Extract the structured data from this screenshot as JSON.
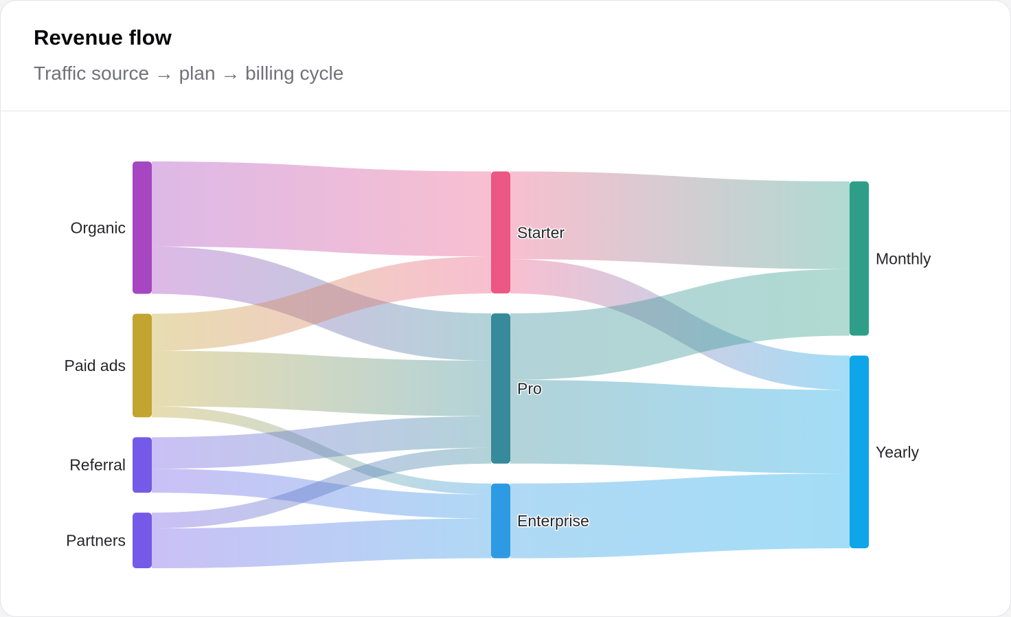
{
  "header": {
    "title": "Revenue flow",
    "subtitle": "Traffic source → plan → billing cycle"
  },
  "chart_data": {
    "type": "sankey",
    "title": "Revenue flow",
    "subtitle": "Traffic source → plan → billing cycle",
    "columns": [
      [
        "Organic",
        "Paid ads",
        "Referral",
        "Partners"
      ],
      [
        "Starter",
        "Pro",
        "Enterprise"
      ],
      [
        "Monthly",
        "Yearly"
      ]
    ],
    "nodes": [
      {
        "name": "Organic",
        "color": "#a646c0"
      },
      {
        "name": "Paid ads",
        "color": "#c2a431"
      },
      {
        "name": "Referral",
        "color": "#745ae6"
      },
      {
        "name": "Partners",
        "color": "#745ae6"
      },
      {
        "name": "Starter",
        "color": "#ec5784"
      },
      {
        "name": "Pro",
        "color": "#368a99"
      },
      {
        "name": "Enterprise",
        "color": "#2e9ae4"
      },
      {
        "name": "Monthly",
        "color": "#2f9e88"
      },
      {
        "name": "Yearly",
        "color": "#0ea5e9"
      }
    ],
    "links": [
      {
        "source": "Organic",
        "target": "Starter",
        "value": 124
      },
      {
        "source": "Organic",
        "target": "Pro",
        "value": 69
      },
      {
        "source": "Paid ads",
        "target": "Starter",
        "value": 54
      },
      {
        "source": "Paid ads",
        "target": "Pro",
        "value": 81
      },
      {
        "source": "Paid ads",
        "target": "Enterprise",
        "value": 16
      },
      {
        "source": "Referral",
        "target": "Pro",
        "value": 46
      },
      {
        "source": "Referral",
        "target": "Enterprise",
        "value": 35
      },
      {
        "source": "Partners",
        "target": "Pro",
        "value": 23
      },
      {
        "source": "Partners",
        "target": "Enterprise",
        "value": 58
      },
      {
        "source": "Starter",
        "target": "Monthly",
        "value": 128
      },
      {
        "source": "Starter",
        "target": "Yearly",
        "value": 50
      },
      {
        "source": "Pro",
        "target": "Monthly",
        "value": 97
      },
      {
        "source": "Pro",
        "target": "Yearly",
        "value": 122
      },
      {
        "source": "Enterprise",
        "target": "Yearly",
        "value": 109
      }
    ]
  }
}
